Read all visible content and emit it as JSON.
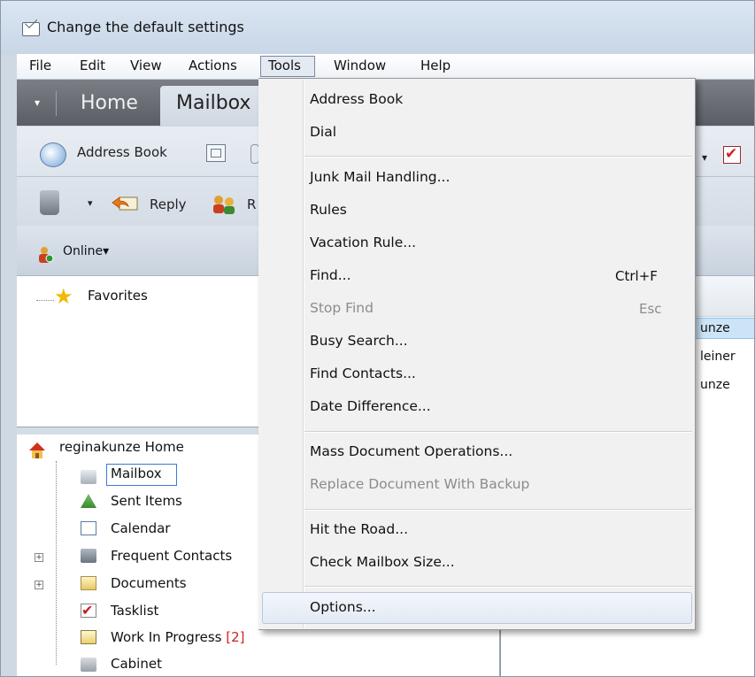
{
  "window": {
    "title": "Change the default settings"
  },
  "menubar": {
    "items": [
      "File",
      "Edit",
      "View",
      "Actions",
      "Tools",
      "Window",
      "Help"
    ]
  },
  "navbar": {
    "dropdown_glyph": "▾",
    "home_label": "Home",
    "mailbox_label": "Mailbox"
  },
  "toolbar": {
    "address_book_label": "Address Book",
    "reply_label": "Reply",
    "r_label": "R",
    "dropdown_glyph": "▾",
    "check_glyph": "✔"
  },
  "status": {
    "online_label": "Online▾"
  },
  "favorites": {
    "label": "Favorites",
    "star_glyph": "★"
  },
  "tree": {
    "home_label": "reginakunze Home",
    "items": [
      {
        "label": "Mailbox",
        "icon": "mailbox-icon"
      },
      {
        "label": "Sent Items",
        "icon": "sent-items-icon"
      },
      {
        "label": "Calendar",
        "icon": "calendar-icon"
      },
      {
        "label": "Frequent Contacts",
        "icon": "contacts-icon",
        "expander": "+"
      },
      {
        "label": "Documents",
        "icon": "documents-icon",
        "expander": "+"
      },
      {
        "label": "Tasklist",
        "icon": "tasklist-icon"
      },
      {
        "label": "Work In Progress",
        "icon": "work-in-progress-icon",
        "count": "[2]"
      },
      {
        "label": "Cabinet",
        "icon": "cabinet-icon"
      }
    ]
  },
  "right_pane": {
    "rows": [
      "unze",
      "leiner",
      "unze"
    ]
  },
  "tools_menu": {
    "items": [
      {
        "label": "Address Book",
        "shortcut": "",
        "disabled": false
      },
      {
        "label": "Dial",
        "shortcut": "",
        "disabled": false
      },
      {
        "label": "Junk Mail Handling...",
        "shortcut": "",
        "disabled": false
      },
      {
        "label": "Rules",
        "shortcut": "",
        "disabled": false
      },
      {
        "label": "Vacation Rule...",
        "shortcut": "",
        "disabled": false
      },
      {
        "label": "Find...",
        "shortcut": "Ctrl+F",
        "disabled": false
      },
      {
        "label": "Stop Find",
        "shortcut": "Esc",
        "disabled": true
      },
      {
        "label": "Busy Search...",
        "shortcut": "",
        "disabled": false
      },
      {
        "label": "Find Contacts...",
        "shortcut": "",
        "disabled": false
      },
      {
        "label": "Date Difference...",
        "shortcut": "",
        "disabled": false
      },
      {
        "label": "Mass Document Operations...",
        "shortcut": "",
        "disabled": false
      },
      {
        "label": "Replace Document With Backup",
        "shortcut": "",
        "disabled": true
      },
      {
        "label": "Hit the Road...",
        "shortcut": "",
        "disabled": false
      },
      {
        "label": "Check Mailbox Size...",
        "shortcut": "",
        "disabled": false
      },
      {
        "label": "Options...",
        "shortcut": "",
        "disabled": false,
        "highlighted": true
      }
    ]
  },
  "colors": {
    "menu_bg": "#f1f1f1",
    "disabled_text": "#8c8c8c",
    "selection": "#cce4f7",
    "badge_red": "#d12020",
    "nav_dark": "#5a5e64"
  }
}
